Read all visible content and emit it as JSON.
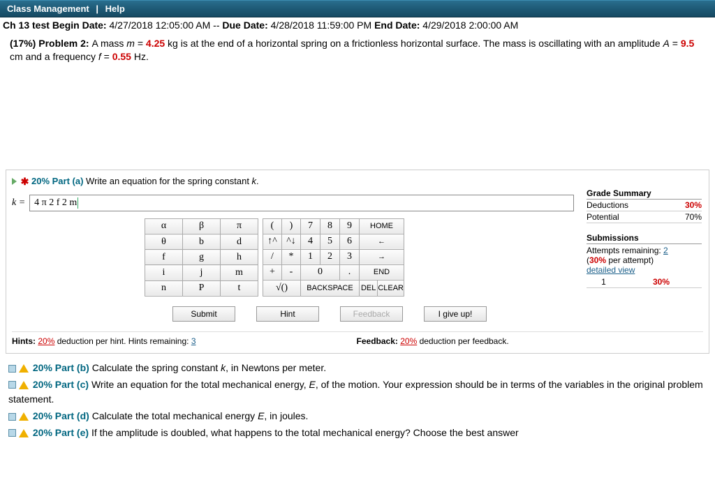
{
  "topbar": {
    "class_mgmt": "Class Management",
    "sep": "|",
    "help": "Help"
  },
  "assignment": {
    "title_prefix": "Ch 13 test ",
    "begin_label": "Begin Date:",
    "begin": " 4/27/2018 12:05:00 AM -- ",
    "due_label": "Due Date:",
    "due": " 4/28/2018 11:59:00 PM ",
    "end_label": "End Date:",
    "end": " 4/29/2018 2:00:00 AM"
  },
  "problem": {
    "weight_label": "(17%) Problem 2: ",
    "text1": "A mass ",
    "m_var": "m",
    "eq1": " = ",
    "m_val": "4.25",
    "text2": " kg is at the end of a horizontal spring on a frictionless horizontal surface. The mass is oscillating with an amplitude ",
    "A_var": "A",
    "eq2": " = ",
    "A_val": "9.5",
    "text3": " cm and a frequency ",
    "f_var": "f",
    "eq3": " = ",
    "f_val": "0.55",
    "text4": " Hz."
  },
  "part_a": {
    "weight": "20% Part (a) ",
    "prompt": "Write an equation for the spring constant ",
    "kvar": "k",
    "period": ".",
    "k_eq": "k = ",
    "answer": "4 π 2 f 2 m"
  },
  "grade": {
    "title": "Grade Summary",
    "ded_label": "Deductions",
    "ded_val": "30%",
    "pot_label": "Potential",
    "pot_val": "70%",
    "sub_title": "Submissions",
    "att_label": "Attempts remaining: ",
    "att_remaining": "2",
    "per_attempt_a": "(",
    "per_attempt_b": "30%",
    "per_attempt_c": " per attempt)",
    "detailed": "detailed view",
    "row1_n": "1",
    "row1_v": "30%"
  },
  "keypad": {
    "r0": [
      "α",
      "β",
      "π",
      "(",
      ")",
      "7",
      "8",
      "9",
      "HOME"
    ],
    "r1": [
      "θ",
      "b",
      "d",
      "↑^",
      "^↓",
      "4",
      "5",
      "6",
      "←"
    ],
    "r2": [
      "f",
      "g",
      "h",
      "/",
      "*",
      "1",
      "2",
      "3",
      "→"
    ],
    "r3": [
      "i",
      "j",
      "m",
      "+",
      "-",
      "0",
      ".",
      "END"
    ],
    "r4": [
      "n",
      "P",
      "t",
      "√()",
      "BACKSPACE",
      "DEL",
      "CLEAR"
    ]
  },
  "actions": {
    "submit": "Submit",
    "hint": "Hint",
    "feedback": "Feedback",
    "giveup": "I give up!"
  },
  "hints": {
    "label": "Hints: ",
    "pct": "20%",
    "rest": " deduction per hint. Hints remaining: ",
    "remain": "3",
    "fb_label": "Feedback: ",
    "fb_pct": "20%",
    "fb_rest": " deduction per feedback."
  },
  "parts": {
    "b": {
      "w": "20% Part (b) ",
      "t": "Calculate the spring constant ",
      "v": "k",
      "r": ", in Newtons per meter."
    },
    "c": {
      "w": "20% Part (c) ",
      "t": "Write an equation for the total mechanical energy, ",
      "v": "E",
      "r": ", of the motion. Your expression should be in terms of the variables in the original problem statement."
    },
    "d": {
      "w": "20% Part (d) ",
      "t": "Calculate the total mechanical energy ",
      "v": "E",
      "r": ", in joules."
    },
    "e": {
      "w": "20% Part (e) ",
      "t": "If the amplitude is doubled, what happens to the total mechanical energy? Choose the best answer"
    }
  }
}
